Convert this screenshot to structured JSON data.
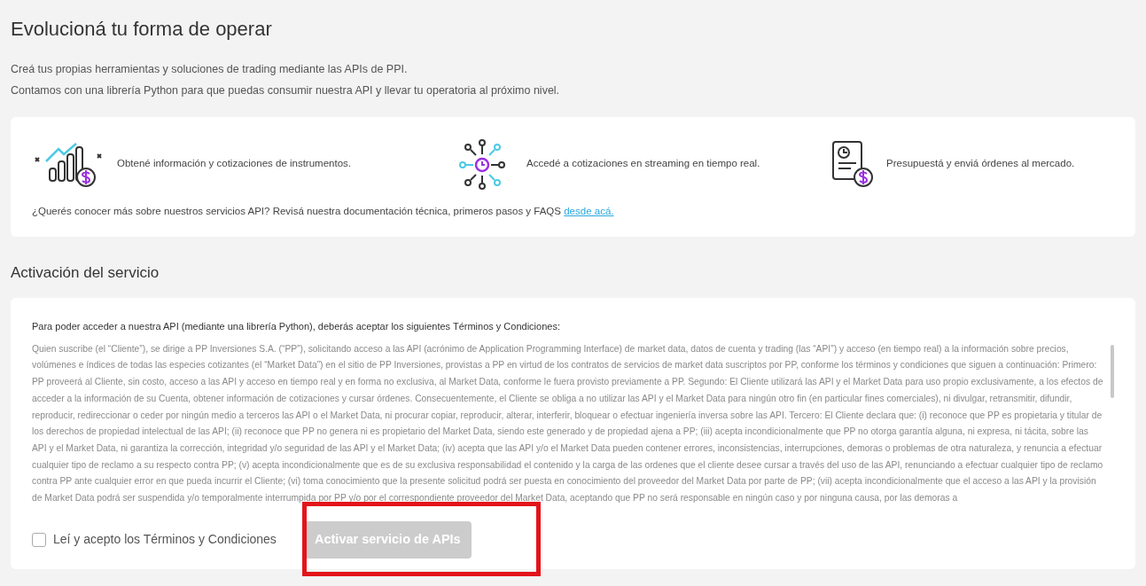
{
  "title": "Evolucioná tu forma de operar",
  "intro": [
    "Creá tus propias herramientas y soluciones de trading mediante las APIs de PPI.",
    "Contamos con una librería Python para que puedas consumir nuestra API y llevar tu operatoria al próximo nivel."
  ],
  "features": [
    {
      "kind": "chart",
      "text": "Obtené información y cotizaciones de instrumentos."
    },
    {
      "kind": "network",
      "text": "Accedé a cotizaciones en streaming en tiempo real."
    },
    {
      "kind": "document",
      "text": "Presupuestá y enviá órdenes al mercado."
    }
  ],
  "docs": {
    "text": "¿Querés conocer más sobre nuestros servicios API? Revisá nuestra documentación técnica, primeros pasos y FAQS",
    "link": "desde acá."
  },
  "activation": {
    "heading": "Activación del servicio",
    "intro": "Para poder acceder a nuestra API (mediante una librería Python), deberás aceptar los siguientes Términos y Condiciones:",
    "terms": "Quien suscribe (el “Cliente”), se dirige a PP Inversiones S.A. (“PP”), solicitando acceso a las API (acrónimo de Application Programming Interface) de market data, datos de cuenta y trading (las “API”) y acceso (en tiempo real) a la información sobre precios, volúmenes e índices de todas las especies cotizantes (el “Market Data”) en el sitio de PP Inversiones, provistas a PP en virtud de los contratos de servicios de market data suscriptos por PP, conforme los términos y condiciones que siguen a continuación: Primero: PP proveerá al Cliente, sin costo, acceso a las API y acceso en tiempo real y en forma no exclusiva, al Market Data, conforme le fuera provisto previamente a PP. Segundo: El Cliente utilizará las API y el Market Data para uso propio exclusivamente, a los efectos de acceder a la información de su Cuenta, obtener información de cotizaciones y cursar órdenes. Consecuentemente, el Cliente se obliga a no utilizar las API y el Market Data para ningún otro fin (en particular fines comerciales), ni divulgar, retransmitir, difundir, reproducir, redireccionar o ceder por ningún medio a terceros las API o el Market Data, ni procurar copiar, reproducir, alterar, interferir, bloquear o efectuar ingeniería inversa sobre las API. Tercero: El Cliente declara que: (i) reconoce que PP es propietaria y titular de los derechos de propiedad intelectual de las API; (ii) reconoce que PP no genera ni es propietario del Market Data, siendo este generado y de propiedad ajena a PP; (iii) acepta incondicionalmente que PP no otorga garantía alguna, ni expresa, ni tácita, sobre las API y el Market Data, ni garantiza la corrección, integridad y/o seguridad de las API y el Market Data; (iv) acepta que las API y/o el Market Data pueden contener errores, inconsistencias, interrupciones, demoras o problemas de otra naturaleza, y renuncia a efectuar cualquier tipo de reclamo a su respecto contra PP; (v) acepta incondicionalmente que es de su exclusiva responsabilidad el contenido y la carga de las ordenes que el cliente desee cursar a través del uso de las API, renunciando a efectuar cualquier tipo de reclamo contra PP ante cualquier error en que pueda incurrir el Cliente; (vi) toma conocimiento que la presente solicitud podrá ser puesta en conocimiento del proveedor del Market Data por parte de PP; (vii) acepta incondicionalmente que el acceso a las API y la provisión de Market Data podrá ser suspendida y/o temporalmente interrumpida por PP y/o por el correspondiente proveedor del Market Data, aceptando que PP no será responsable en ningún caso y por ninguna causa, por las demoras a",
    "accept": {
      "label": "Leí y acepto los Términos y Condiciones",
      "checked": false
    },
    "button": {
      "label": "Activar servicio de APIs",
      "disabled": true
    }
  }
}
